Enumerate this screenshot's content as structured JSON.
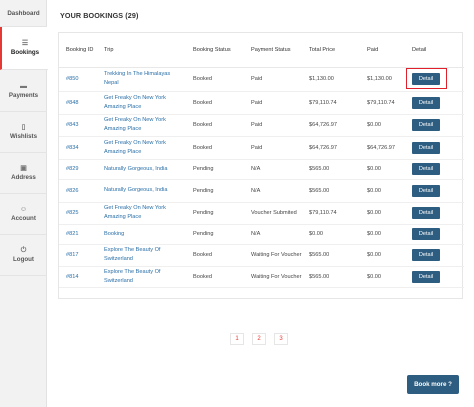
{
  "sidebar": {
    "items": [
      {
        "label": "Dashboard",
        "icon": ""
      },
      {
        "label": "Bookings",
        "icon": "list-icon"
      },
      {
        "label": "Payments",
        "icon": "card-icon"
      },
      {
        "label": "Wishlists",
        "icon": "bookmark-icon"
      },
      {
        "label": "Address",
        "icon": "address-icon"
      },
      {
        "label": "Account",
        "icon": "user-icon"
      },
      {
        "label": "Logout",
        "icon": "power-icon"
      }
    ]
  },
  "main": {
    "title": "YOUR BOOKINGS (29)",
    "columns": [
      "Booking ID",
      "Trip",
      "Booking Status",
      "Payment Status",
      "Total Price",
      "Paid",
      "Detail"
    ],
    "rows": [
      {
        "id": "#850",
        "trip": "Trekking In The Himalayas Nepal",
        "booking_status": "Booked",
        "payment_status": "Paid",
        "total": "$1,130.00",
        "paid": "$1,130.00",
        "detail": "Detail"
      },
      {
        "id": "#848",
        "trip": "Get Freaky On New York Amazing Place",
        "booking_status": "Booked",
        "payment_status": "Paid",
        "total": "$79,110.74",
        "paid": "$79,110.74",
        "detail": "Detail"
      },
      {
        "id": "#843",
        "trip": "Get Freaky On New York Amazing Place",
        "booking_status": "Booked",
        "payment_status": "Paid",
        "total": "$64,726.97",
        "paid": "$0.00",
        "detail": "Detail"
      },
      {
        "id": "#834",
        "trip": "Get Freaky On New York Amazing Place",
        "booking_status": "Booked",
        "payment_status": "Paid",
        "total": "$64,726.97",
        "paid": "$64,726.97",
        "detail": "Detail"
      },
      {
        "id": "#829",
        "trip": "Naturally Gorgeous, India",
        "booking_status": "Pending",
        "payment_status": "N/A",
        "total": "$565.00",
        "paid": "$0.00",
        "detail": "Detail"
      },
      {
        "id": "#826",
        "trip": "Naturally Gorgeous, India",
        "booking_status": "Pending",
        "payment_status": "N/A",
        "total": "$565.00",
        "paid": "$0.00",
        "detail": "Detail"
      },
      {
        "id": "#825",
        "trip": "Get Freaky On New York Amazing Place",
        "booking_status": "Pending",
        "payment_status": "Voucher Submited",
        "total": "$79,110.74",
        "paid": "$0.00",
        "detail": "Detail"
      },
      {
        "id": "#821",
        "trip": "Booking",
        "booking_status": "Pending",
        "payment_status": "N/A",
        "total": "$0.00",
        "paid": "$0.00",
        "detail": "Detail"
      },
      {
        "id": "#817",
        "trip": "Explore The Beauty Of Switzerland",
        "booking_status": "Booked",
        "payment_status": "Waiting For Voucher",
        "total": "$565.00",
        "paid": "$0.00",
        "detail": "Detail"
      },
      {
        "id": "#814",
        "trip": "Explore The Beauty Of Switzerland",
        "booking_status": "Booked",
        "payment_status": "Waiting For Voucher",
        "total": "$565.00",
        "paid": "$0.00",
        "detail": "Detail"
      }
    ]
  },
  "pagination": {
    "pages": [
      "1",
      "2",
      "3"
    ]
  },
  "actions": {
    "book_more": "Book more ?"
  },
  "colors": {
    "accent": "#2d5d80",
    "highlight": "#e0212b",
    "active_marker": "#e53935",
    "link": "#2a6fa8"
  }
}
